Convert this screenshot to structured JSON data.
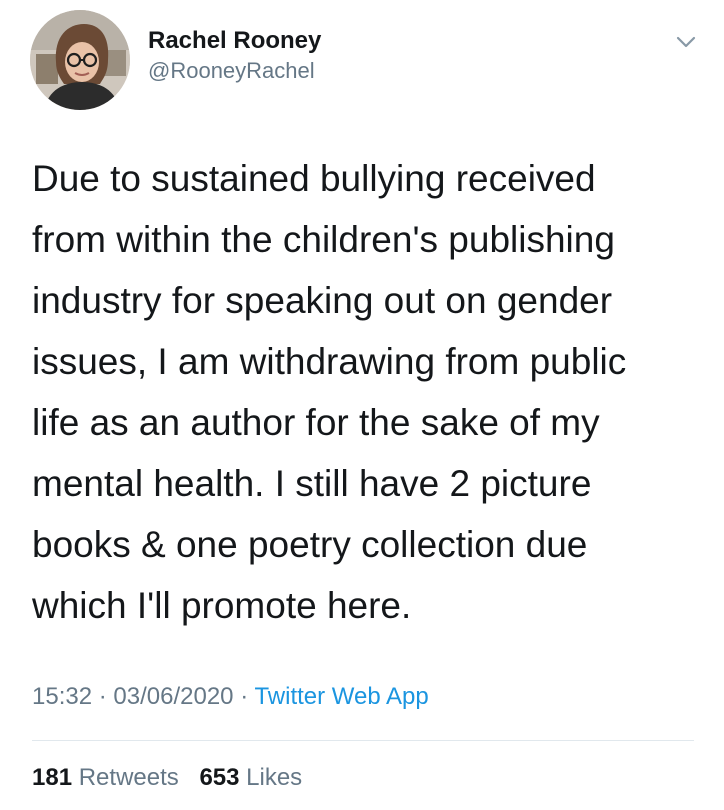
{
  "user": {
    "display_name": "Rachel Rooney",
    "handle": "@RooneyRachel"
  },
  "tweet": {
    "text": "Due to sustained bullying received\nfrom within the children's publishing\nindustry for speaking out on gender\nissues, I am withdrawing from public\nlife as an author for the sake of my\nmental health. I still have 2 picture\nbooks & one poetry collection due\nwhich I'll promote here."
  },
  "meta": {
    "time": "15:32",
    "separator": "·",
    "date": "03/06/2020",
    "source": "Twitter Web App"
  },
  "stats": {
    "retweets_count": "181",
    "retweets_label": "Retweets",
    "likes_count": "653",
    "likes_label": "Likes"
  },
  "icons": {
    "menu": "chevron-down-icon",
    "avatar": "profile-photo"
  },
  "colors": {
    "text": "#14171a",
    "secondary": "#657786",
    "link": "#1b95e0",
    "divider": "#e1e8ed"
  }
}
